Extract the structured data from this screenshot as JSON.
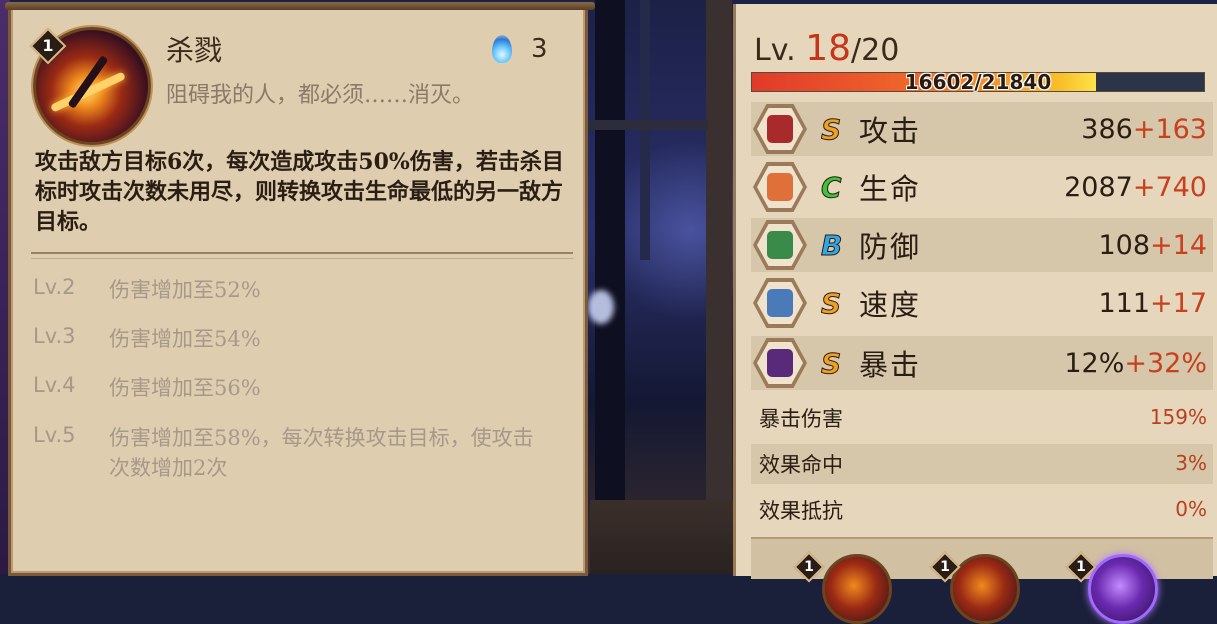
{
  "skill": {
    "level_badge": "1",
    "name": "杀戮",
    "quote": "阻碍我的人，都必须……消灭。",
    "cost": "3",
    "description": "攻击敌方目标6次，每次造成攻击50%伤害，若击杀目标时攻击次数未用尽，则转换攻击生命最低的另一敌方目标。",
    "upgrades": [
      {
        "level": "Lv.2",
        "text": "伤害增加至52%"
      },
      {
        "level": "Lv.3",
        "text": "伤害增加至54%"
      },
      {
        "level": "Lv.4",
        "text": "伤害增加至56%"
      },
      {
        "level": "Lv.5",
        "text": "伤害增加至58%，每次转换攻击目标，使攻击次数增加2次"
      }
    ]
  },
  "stats": {
    "level_prefix": "Lv.",
    "level_current": "18",
    "level_max": "/20",
    "xp_text": "16602/21840",
    "xp_fraction": 0.76,
    "main": [
      {
        "icon": "fan-icon",
        "grade": "S",
        "name": "攻击",
        "base": "386",
        "bonus": "+163",
        "grade_color": "#f0a020"
      },
      {
        "icon": "talisman-icon",
        "grade": "C",
        "name": "生命",
        "base": "2087",
        "bonus": "+740",
        "grade_color": "#3cc43c"
      },
      {
        "icon": "armor-icon",
        "grade": "B",
        "name": "防御",
        "base": "108",
        "bonus": "+14",
        "grade_color": "#30a8e8"
      },
      {
        "icon": "wind-icon",
        "grade": "S",
        "name": "速度",
        "base": "111",
        "bonus": "+17",
        "grade_color": "#f0a020"
      },
      {
        "icon": "scroll-icon",
        "grade": "S",
        "name": "暴击",
        "base": "12%",
        "bonus": "+32%",
        "grade_color": "#f0a020"
      }
    ],
    "sub": [
      {
        "name": "暴击伤害",
        "value": "159%"
      },
      {
        "name": "效果命中",
        "value": "3%"
      },
      {
        "name": "效果抵抗",
        "value": "0%"
      }
    ],
    "skill_slots": [
      {
        "badge": "1"
      },
      {
        "badge": "1"
      },
      {
        "badge": "1"
      }
    ]
  }
}
